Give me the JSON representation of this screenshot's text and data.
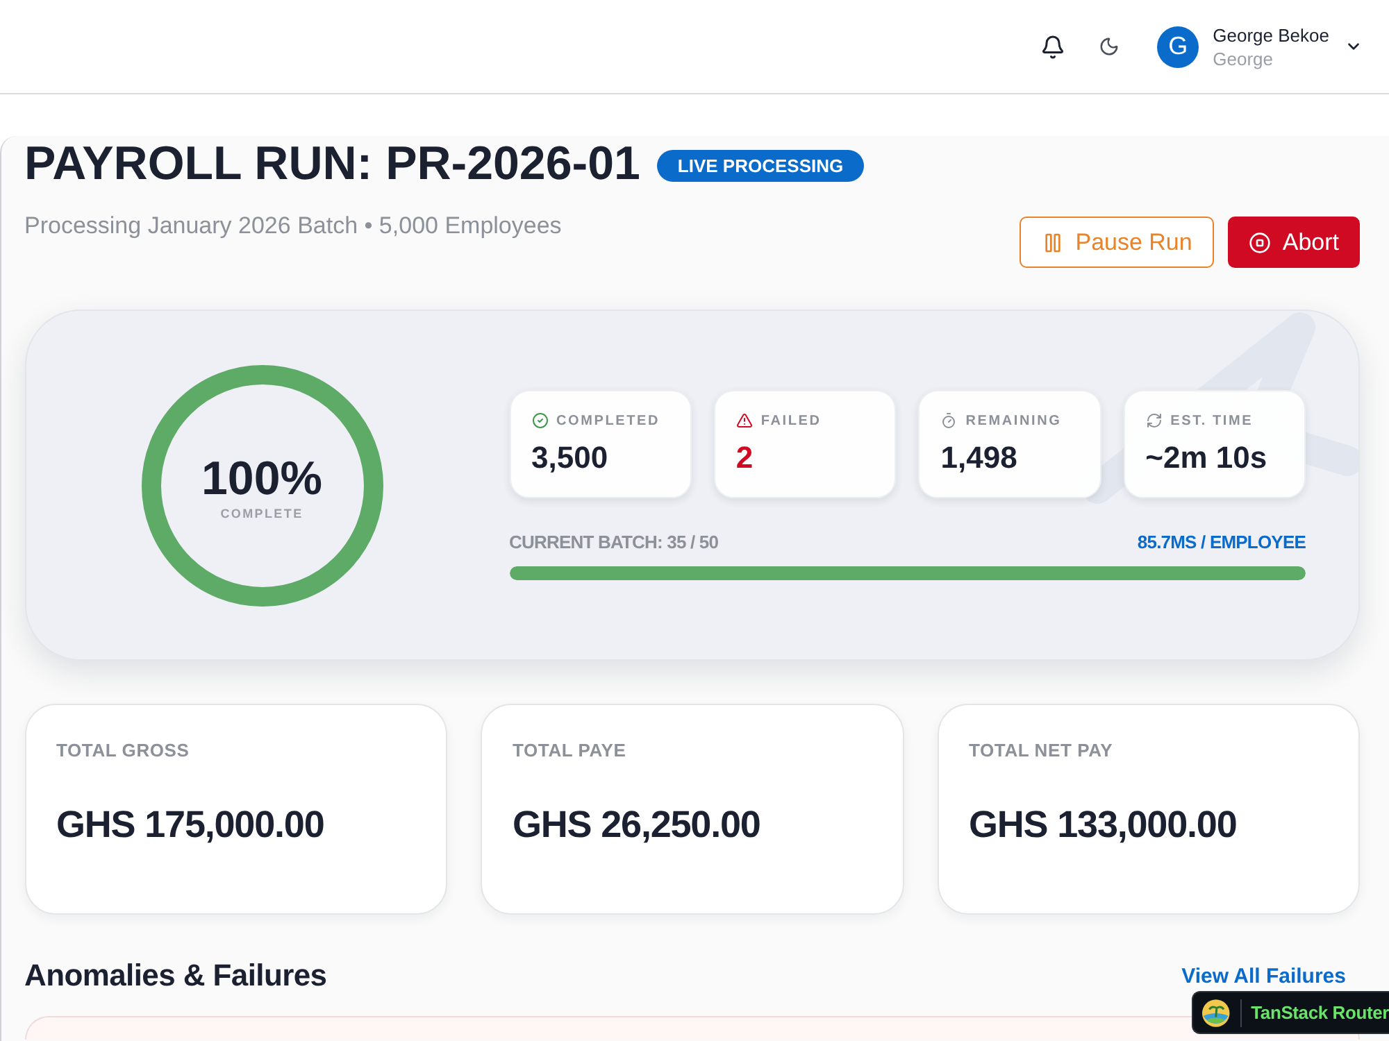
{
  "header": {
    "user": {
      "initial": "G",
      "name": "George Bekoe",
      "role": "George"
    }
  },
  "run": {
    "title": "PAYROLL RUN: PR-2026-01",
    "status": "LIVE PROCESSING",
    "subtitle": "Processing January 2026 Batch • 5,000 Employees",
    "actions": [
      {
        "kind": "pause",
        "label": "Pause Run"
      },
      {
        "kind": "abort",
        "label": "Abort"
      }
    ]
  },
  "progress": {
    "percent": "100%",
    "caption": "COMPLETE",
    "level": 1,
    "stats": [
      {
        "kind": "completed",
        "label": "COMPLETED",
        "value": "3,500"
      },
      {
        "kind": "failed",
        "label": "FAILED",
        "value": "2"
      },
      {
        "kind": "remaining",
        "label": "REMAINING",
        "value": "1,498"
      },
      {
        "kind": "time",
        "label": "EST. TIME",
        "value": "~2m 10s"
      }
    ],
    "batch": {
      "label": "CURRENT BATCH: 35 / 50",
      "rate": "85.7MS / EMPLOYEE",
      "level": 1
    }
  },
  "totals": [
    {
      "label": "TOTAL GROSS",
      "value": "GHS 175,000.00"
    },
    {
      "label": "TOTAL PAYE",
      "value": "GHS 26,250.00"
    },
    {
      "label": "TOTAL NET PAY",
      "value": "GHS 133,000.00"
    }
  ],
  "anomalies": {
    "title": "Anomalies & Failures",
    "link": "View All Failures"
  },
  "devtools": {
    "label": "TanStack Router"
  }
}
